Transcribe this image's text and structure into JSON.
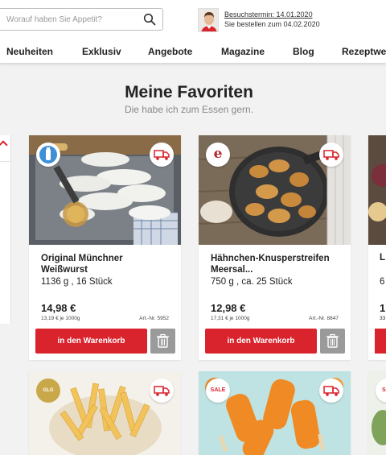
{
  "search": {
    "placeholder": "Worauf haben Sie Appetit?"
  },
  "visit": {
    "appointment": "Besuchstermin: 14.01.2020",
    "order_by": "Sie bestellen zum 04.02.2020"
  },
  "nav": [
    "Neuheiten",
    "Exklusiv",
    "Angebote",
    "Magazine",
    "Blog",
    "Rezeptwe"
  ],
  "page": {
    "title": "Meine Favoriten",
    "subtitle": "Die habe ich zum Essen gern."
  },
  "products": [
    {
      "name": "Original Münchner Weißwurst",
      "qty": "1136 g , 16 Stück",
      "price": "14,98 €",
      "unit_price": "13,19 € je 1000g",
      "article": "Art.-Nr. 5952",
      "cart_label": "in den Warenkorb"
    },
    {
      "name": "Hähnchen-Knusperstreifen Meersal...",
      "qty": "750 g , ca. 25 Stück",
      "price": "12,98 €",
      "unit_price": "17,31 € je 1000g",
      "article": "Art.-Nr. 8847",
      "cart_label": "in den Warenkorb"
    },
    {
      "name": "L",
      "qty": "6",
      "price": "1",
      "unit_price": "33",
      "article": "",
      "cart_label": ""
    },
    {
      "badge": "GLG"
    },
    {
      "badge": "SALE"
    },
    {
      "badge": "SA"
    }
  ],
  "colors": {
    "accent": "#d9232d",
    "trash": "#9a9a9a"
  }
}
